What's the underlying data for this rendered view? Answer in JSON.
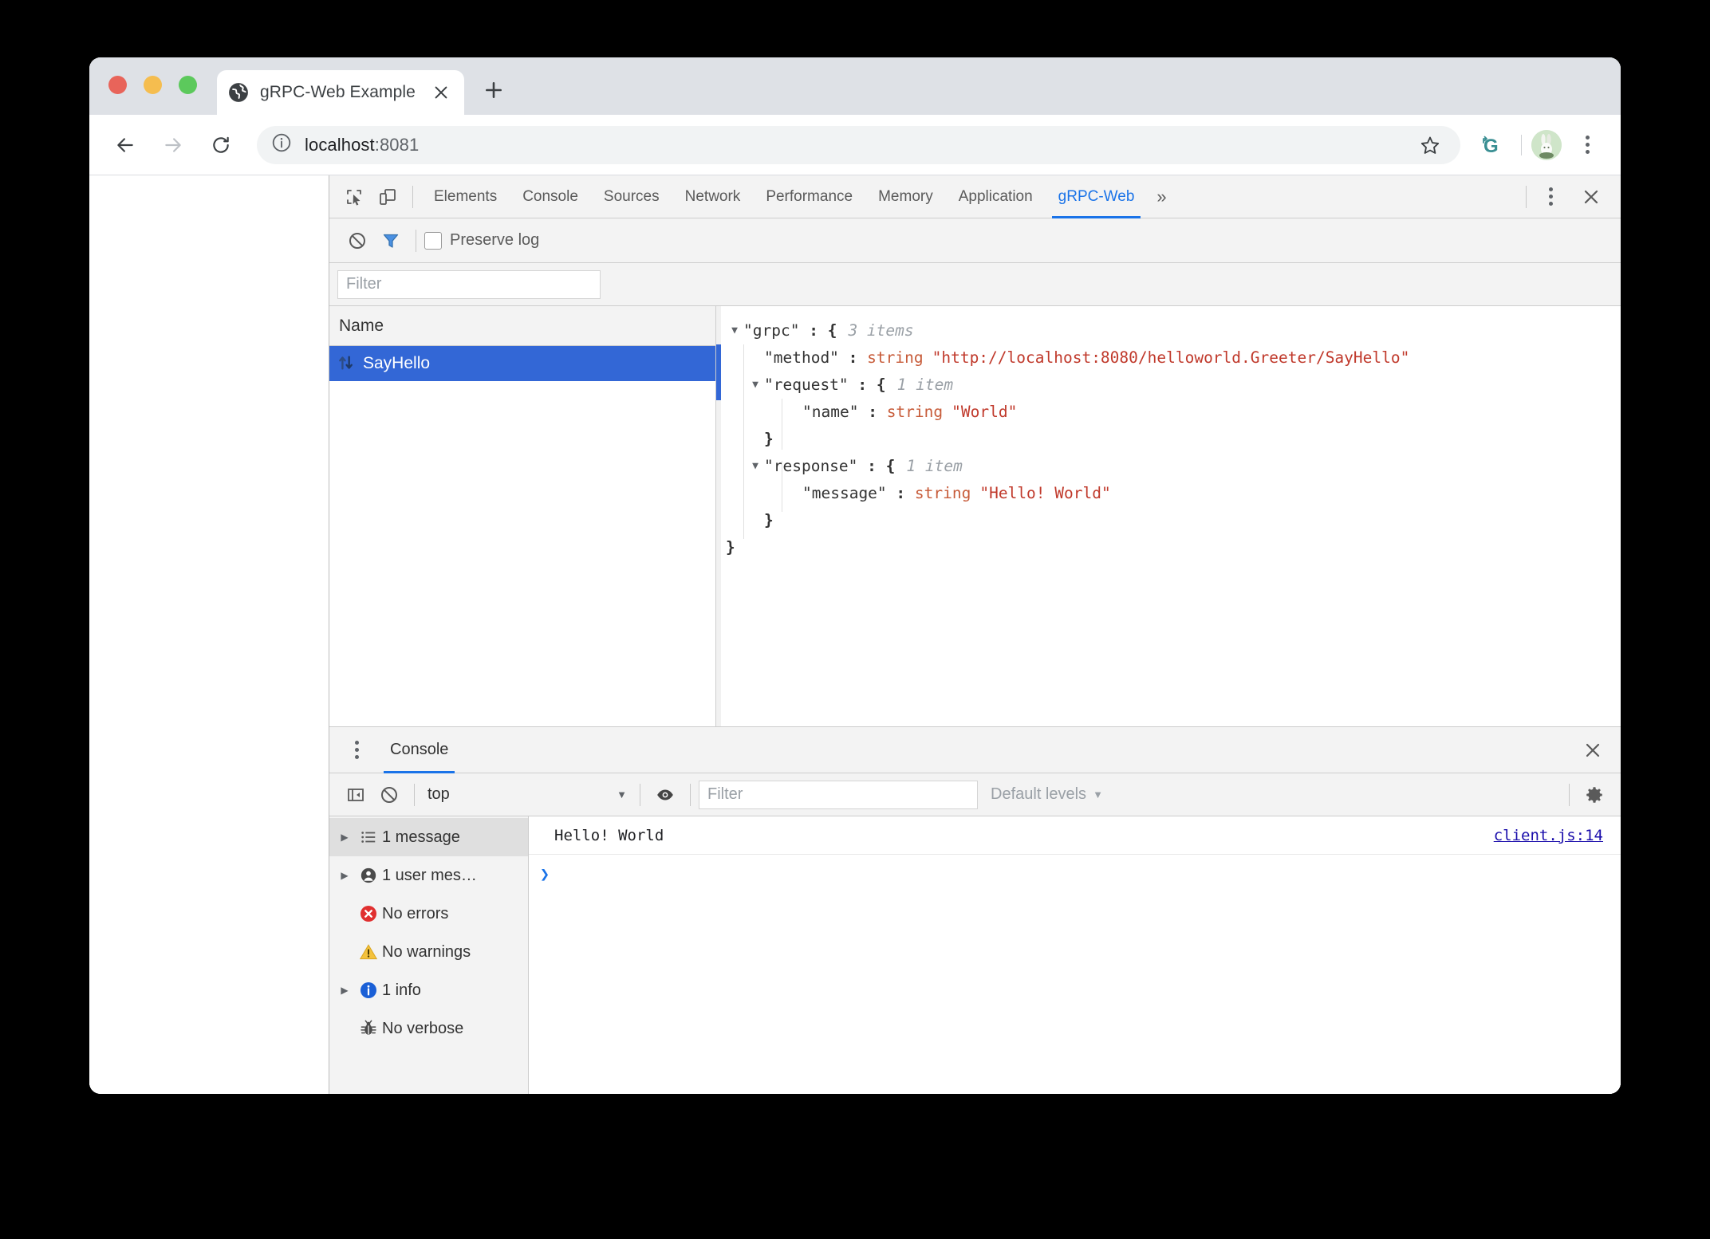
{
  "browser": {
    "tab": {
      "title": "gRPC-Web Example",
      "favicon": "globe-icon",
      "close": "×"
    },
    "new_tab_label": "+",
    "url_host": "localhost",
    "url_port": ":8081",
    "security_icon": "info-circle-icon",
    "back_icon": "arrow-left-icon",
    "forward_icon": "arrow-right-icon",
    "reload_icon": "reload-icon",
    "star_icon": "star-icon",
    "extension_icon": "grpc-extension-icon",
    "extension_label": "G",
    "avatar": "profile-avatar",
    "menu_icon": "three-dot-menu-icon"
  },
  "devtools": {
    "inspect_icon": "inspect-element-icon",
    "device_icon": "device-toolbar-icon",
    "tabs": [
      {
        "label": "Elements",
        "active": false
      },
      {
        "label": "Console",
        "active": false
      },
      {
        "label": "Sources",
        "active": false
      },
      {
        "label": "Network",
        "active": false
      },
      {
        "label": "Performance",
        "active": false
      },
      {
        "label": "Memory",
        "active": false
      },
      {
        "label": "Application",
        "active": false
      },
      {
        "label": "gRPC-Web",
        "active": true
      }
    ],
    "more_tabs": "»",
    "settings_icon": "three-dot-menu-icon",
    "close_icon": "close-icon"
  },
  "grpc_panel": {
    "clear_icon": "clear-log-icon",
    "filter_icon": "filter-funnel-icon",
    "preserve_log_label": "Preserve log",
    "preserve_log_checked": false,
    "filter_placeholder": "Filter",
    "filter_value": "",
    "name_column_header": "Name",
    "entries": [
      {
        "name": "SayHello",
        "icon": "up-down-arrows-icon",
        "selected": true
      }
    ],
    "json_tree": [
      {
        "indent": 0,
        "triangle": "▼",
        "key": "\"grpc\"",
        "sep": " : ",
        "brace": "{",
        "count": "3 items"
      },
      {
        "indent": 1,
        "triangle": "",
        "key": "\"method\"",
        "sep": " : ",
        "type": "string",
        "value": "\"http://localhost:8080/helloworld.Greeter/SayHello\""
      },
      {
        "indent": 1,
        "triangle": "▼",
        "key": "\"request\"",
        "sep": " : ",
        "brace": "{",
        "count": "1 item"
      },
      {
        "indent": 2,
        "triangle": "",
        "key": "\"name\"",
        "sep": " : ",
        "type": "string",
        "value": "\"World\""
      },
      {
        "indent": 1,
        "triangle": "",
        "brace": "}"
      },
      {
        "indent": 1,
        "triangle": "▼",
        "key": "\"response\"",
        "sep": " : ",
        "brace": "{",
        "count": "1 item"
      },
      {
        "indent": 2,
        "triangle": "",
        "key": "\"message\"",
        "sep": " : ",
        "type": "string",
        "value": "\"Hello! World\""
      },
      {
        "indent": 1,
        "triangle": "",
        "brace": "}"
      },
      {
        "indent": 0,
        "triangle": "",
        "brace": "}"
      }
    ]
  },
  "console_drawer": {
    "menu_icon": "three-dot-menu-icon",
    "tab_label": "Console",
    "close_icon": "close-icon",
    "sidebar_toggle_icon": "show-console-sidebar-icon",
    "clear_icon": "clear-console-icon",
    "context_value": "top",
    "context_caret": "▼",
    "eye_icon": "live-expression-icon",
    "filter_placeholder": "Filter",
    "filter_value": "",
    "levels_label": "Default levels",
    "levels_caret": "▼",
    "settings_icon": "gear-icon",
    "sidebar_items": [
      {
        "label": "1 message",
        "icon": "list-icon",
        "arrow": "▶",
        "selected": true
      },
      {
        "label": "1 user mes…",
        "icon": "user-icon",
        "arrow": "▶",
        "selected": false
      },
      {
        "label": "No errors",
        "icon": "error-icon",
        "arrow": "",
        "selected": false
      },
      {
        "label": "No warnings",
        "icon": "warning-icon",
        "arrow": "",
        "selected": false
      },
      {
        "label": "1 info",
        "icon": "info-icon",
        "arrow": "▶",
        "selected": false
      },
      {
        "label": "No verbose",
        "icon": "bug-icon",
        "arrow": "",
        "selected": false
      }
    ],
    "messages": [
      {
        "text": "Hello! World",
        "source": "client.js:14"
      }
    ],
    "prompt_symbol": "❯"
  },
  "colors": {
    "accent": "#1a73e8",
    "selection": "#3367d6",
    "string": "#c0392b",
    "type": "#c75b39",
    "error": "#e02f2f",
    "warning": "#f4b400",
    "info": "#1a73e8",
    "extension": "#3a8f93"
  }
}
